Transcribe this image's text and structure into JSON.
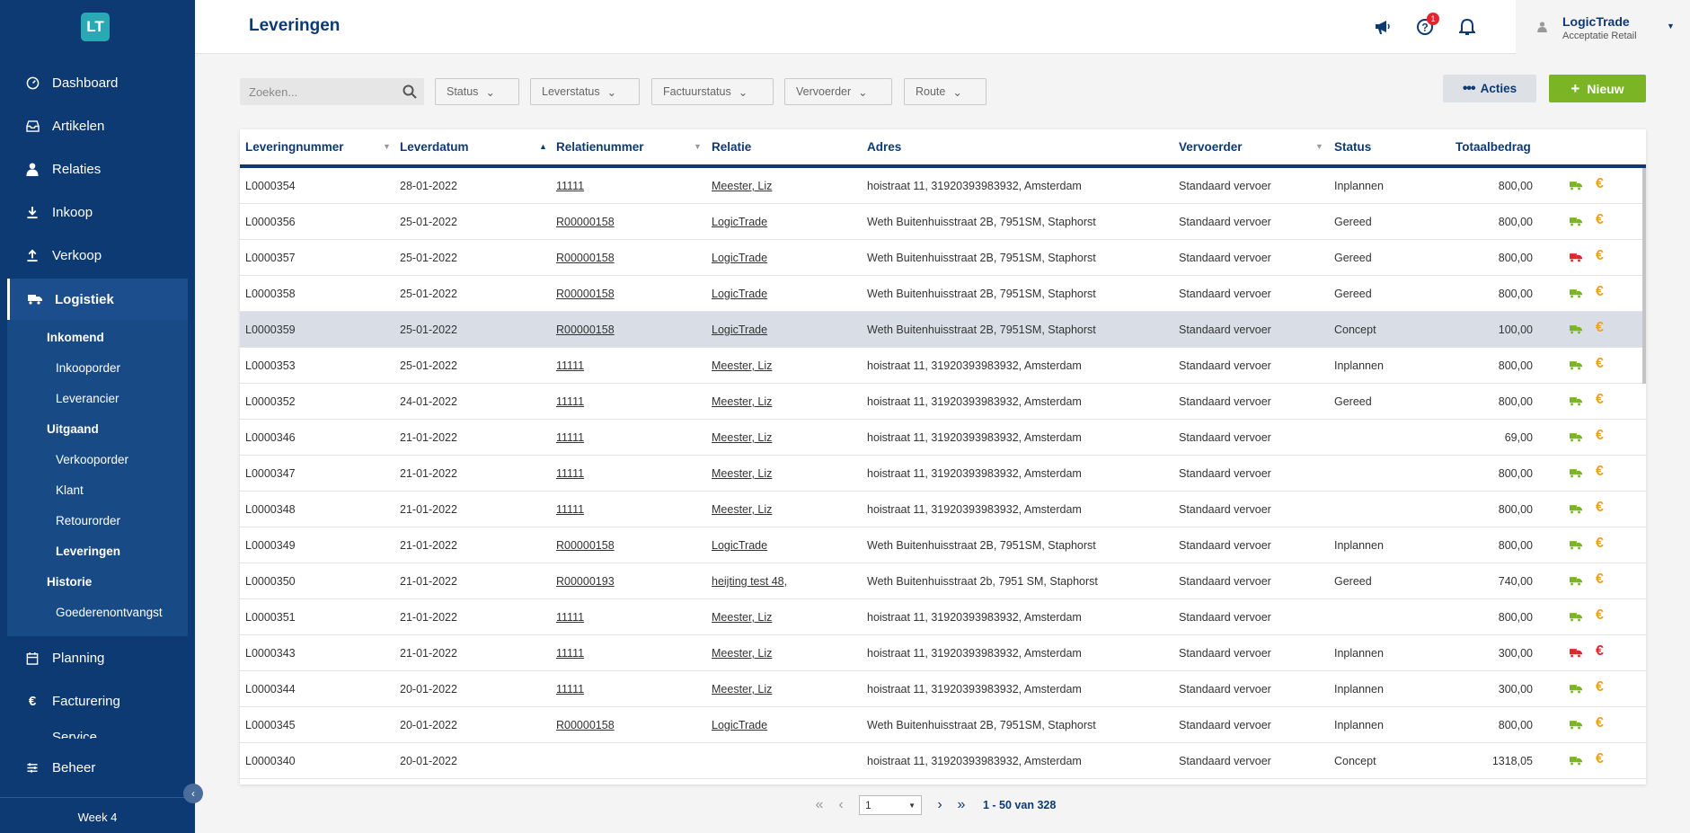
{
  "logo_text": "LT",
  "sidebar": {
    "items_top": [
      {
        "label": "Dashboard",
        "icon": "dashboard-icon"
      },
      {
        "label": "Artikelen",
        "icon": "inbox-icon"
      },
      {
        "label": "Relaties",
        "icon": "person-icon"
      },
      {
        "label": "Inkoop",
        "icon": "download-icon"
      },
      {
        "label": "Verkoop",
        "icon": "upload-icon"
      }
    ],
    "active": {
      "label": "Logistiek",
      "icon": "truck-icon"
    },
    "sub": {
      "inkomend": "Inkomend",
      "inkooporder": "Inkooporder",
      "leverancier": "Leverancier",
      "uitgaand": "Uitgaand",
      "verkooporder": "Verkooporder",
      "klant": "Klant",
      "retourorder": "Retourorder",
      "leveringen": "Leveringen",
      "historie": "Historie",
      "goederenontvangst": "Goederenontvangst"
    },
    "items_bottom": [
      {
        "label": "Planning",
        "icon": "calendar-icon"
      },
      {
        "label": "Facturering",
        "icon": "euro-icon"
      },
      {
        "label": "Service",
        "icon": "service-icon"
      }
    ],
    "beheer": "Beheer",
    "week": "Week 4"
  },
  "header": {
    "title": "Leveringen",
    "notification_count": "1",
    "user_name": "LogicTrade",
    "user_sub": "Acceptatie Retail"
  },
  "toolbar": {
    "search_placeholder": "Zoeken...",
    "filters": [
      "Status",
      "Leverstatus",
      "Factuurstatus",
      "Vervoerder",
      "Route"
    ],
    "acties": "Acties",
    "nieuw": "Nieuw"
  },
  "table": {
    "columns": [
      "Leveringnummer",
      "Leverdatum",
      "Relatienummer",
      "Relatie",
      "Adres",
      "Vervoerder",
      "Status",
      "Totaalbedrag"
    ],
    "rows": [
      {
        "nr": "L0000354",
        "datum": "28-01-2022",
        "relnr": "11111",
        "relatie": "Meester, Liz",
        "adres": "hoistraat 11, 31920393983932, Amsterdam",
        "vervoerder": "Standaard vervoer",
        "status": "Inplannen",
        "bedrag": "800,00",
        "truck": "#7bb526",
        "euro": "#f0a020"
      },
      {
        "nr": "L0000356",
        "datum": "25-01-2022",
        "relnr": "R00000158",
        "relatie": "LogicTrade",
        "adres": "Weth Buitenhuisstraat 2B, 7951SM, Staphorst",
        "vervoerder": "Standaard vervoer",
        "status": "Gereed",
        "bedrag": "800,00",
        "truck": "#7bb526",
        "euro": "#f0a020"
      },
      {
        "nr": "L0000357",
        "datum": "25-01-2022",
        "relnr": "R00000158",
        "relatie": "LogicTrade",
        "adres": "Weth Buitenhuisstraat 2B, 7951SM, Staphorst",
        "vervoerder": "Standaard vervoer",
        "status": "Gereed",
        "bedrag": "800,00",
        "truck": "#e1262d",
        "euro": "#f0a020"
      },
      {
        "nr": "L0000358",
        "datum": "25-01-2022",
        "relnr": "R00000158",
        "relatie": "LogicTrade",
        "adres": "Weth Buitenhuisstraat 2B, 7951SM, Staphorst",
        "vervoerder": "Standaard vervoer",
        "status": "Gereed",
        "bedrag": "800,00",
        "truck": "#7bb526",
        "euro": "#f0a020"
      },
      {
        "nr": "L0000359",
        "datum": "25-01-2022",
        "relnr": "R00000158",
        "relatie": "LogicTrade",
        "adres": "Weth Buitenhuisstraat 2B, 7951SM, Staphorst",
        "vervoerder": "Standaard vervoer",
        "status": "Concept",
        "bedrag": "100,00",
        "truck": "#7bb526",
        "euro": "#f0a020"
      },
      {
        "nr": "L0000353",
        "datum": "25-01-2022",
        "relnr": "11111",
        "relatie": "Meester, Liz",
        "adres": "hoistraat 11, 31920393983932, Amsterdam",
        "vervoerder": "Standaard vervoer",
        "status": "Inplannen",
        "bedrag": "800,00",
        "truck": "#7bb526",
        "euro": "#f0a020"
      },
      {
        "nr": "L0000352",
        "datum": "24-01-2022",
        "relnr": "11111",
        "relatie": "Meester, Liz",
        "adres": "hoistraat 11, 31920393983932, Amsterdam",
        "vervoerder": "Standaard vervoer",
        "status": "Gereed",
        "bedrag": "800,00",
        "truck": "#7bb526",
        "euro": "#f0a020"
      },
      {
        "nr": "L0000346",
        "datum": "21-01-2022",
        "relnr": "11111",
        "relatie": "Meester, Liz",
        "adres": "hoistraat 11, 31920393983932, Amsterdam",
        "vervoerder": "Standaard vervoer",
        "status": "",
        "bedrag": "69,00",
        "truck": "#7bb526",
        "euro": "#f0a020"
      },
      {
        "nr": "L0000347",
        "datum": "21-01-2022",
        "relnr": "11111",
        "relatie": "Meester, Liz",
        "adres": "hoistraat 11, 31920393983932, Amsterdam",
        "vervoerder": "Standaard vervoer",
        "status": "",
        "bedrag": "800,00",
        "truck": "#7bb526",
        "euro": "#f0a020"
      },
      {
        "nr": "L0000348",
        "datum": "21-01-2022",
        "relnr": "11111",
        "relatie": "Meester, Liz",
        "adres": "hoistraat 11, 31920393983932, Amsterdam",
        "vervoerder": "Standaard vervoer",
        "status": "",
        "bedrag": "800,00",
        "truck": "#7bb526",
        "euro": "#f0a020"
      },
      {
        "nr": "L0000349",
        "datum": "21-01-2022",
        "relnr": "R00000158",
        "relatie": "LogicTrade",
        "adres": "Weth Buitenhuisstraat 2B, 7951SM, Staphorst",
        "vervoerder": "Standaard vervoer",
        "status": "Inplannen",
        "bedrag": "800,00",
        "truck": "#7bb526",
        "euro": "#f0a020"
      },
      {
        "nr": "L0000350",
        "datum": "21-01-2022",
        "relnr": "R00000193",
        "relatie": "heijting test 48,",
        "adres": "Weth Buitenhuisstraat 2b, 7951 SM, Staphorst",
        "vervoerder": "Standaard vervoer",
        "status": "Gereed",
        "bedrag": "740,00",
        "truck": "#7bb526",
        "euro": "#f0a020"
      },
      {
        "nr": "L0000351",
        "datum": "21-01-2022",
        "relnr": "11111",
        "relatie": "Meester, Liz",
        "adres": "hoistraat 11, 31920393983932, Amsterdam",
        "vervoerder": "Standaard vervoer",
        "status": "",
        "bedrag": "800,00",
        "truck": "#7bb526",
        "euro": "#f0a020"
      },
      {
        "nr": "L0000343",
        "datum": "21-01-2022",
        "relnr": "11111",
        "relatie": "Meester, Liz",
        "adres": "hoistraat 11, 31920393983932, Amsterdam",
        "vervoerder": "Standaard vervoer",
        "status": "Inplannen",
        "bedrag": "300,00",
        "truck": "#e1262d",
        "euro": "#e1262d"
      },
      {
        "nr": "L0000344",
        "datum": "20-01-2022",
        "relnr": "11111",
        "relatie": "Meester, Liz",
        "adres": "hoistraat 11, 31920393983932, Amsterdam",
        "vervoerder": "Standaard vervoer",
        "status": "Inplannen",
        "bedrag": "300,00",
        "truck": "#7bb526",
        "euro": "#f0a020"
      },
      {
        "nr": "L0000345",
        "datum": "20-01-2022",
        "relnr": "R00000158",
        "relatie": "LogicTrade",
        "adres": "Weth Buitenhuisstraat 2B, 7951SM, Staphorst",
        "vervoerder": "Standaard vervoer",
        "status": "Inplannen",
        "bedrag": "800,00",
        "truck": "#7bb526",
        "euro": "#f0a020"
      },
      {
        "nr": "L0000340",
        "datum": "20-01-2022",
        "relnr": "",
        "relatie": "",
        "adres": "hoistraat 11, 31920393983932, Amsterdam",
        "vervoerder": "Standaard vervoer",
        "status": "Concept",
        "bedrag": "1318,05",
        "truck": "#7bb526",
        "euro": "#f0a020"
      }
    ],
    "selected_row": 4
  },
  "pager": {
    "page": "1",
    "info": "1 - 50 van 328"
  },
  "colors": {
    "navy": "#0d3a73",
    "green": "#7bb526",
    "red": "#e1262d",
    "orange": "#f0a020"
  }
}
